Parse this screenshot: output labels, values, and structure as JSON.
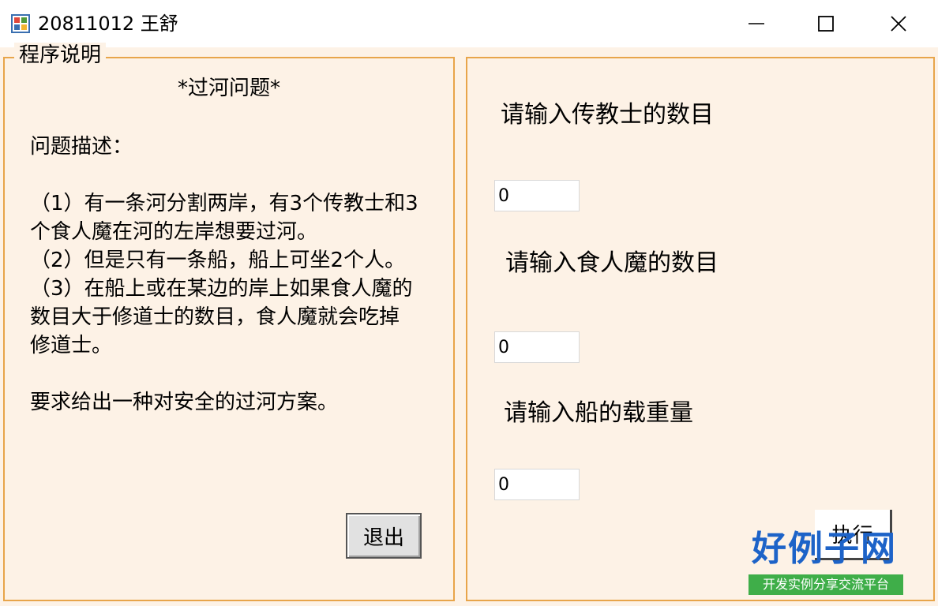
{
  "window": {
    "title": "20811012 王舒",
    "buttons": {
      "minimize": "minimize",
      "maximize": "maximize",
      "close": "close"
    }
  },
  "left_group": {
    "legend": "程序说明",
    "heading": "*过河问题*",
    "desc_title": "问题描述：",
    "desc_lines": [
      "（1）有一条河分割两岸，有3个传教士和3",
      "个食人魔在河的左岸想要过河。",
      "（2）但是只有一条船，船上可坐2个人。",
      "（3）在船上或在某边的岸上如果食人魔的",
      "数目大于修道士的数目，食人魔就会吃掉",
      "修道士。"
    ],
    "requirement": "要求给出一种对安全的过河方案。",
    "exit_button": "退出"
  },
  "right_group": {
    "fields": [
      {
        "label": "请输入传教士的数目",
        "value": "0"
      },
      {
        "label": "请输入食人魔的数目",
        "value": "0"
      },
      {
        "label": "请输入船的载重量",
        "value": "0"
      }
    ],
    "run_button": "执行"
  },
  "watermark": {
    "main": "好例子网",
    "sub": "开发实例分享交流平台"
  },
  "colors": {
    "client_bg": "#fdf2e6",
    "group_border": "#e8a54a",
    "watermark_blue": "#1d63c8",
    "watermark_green": "#3fae49"
  }
}
